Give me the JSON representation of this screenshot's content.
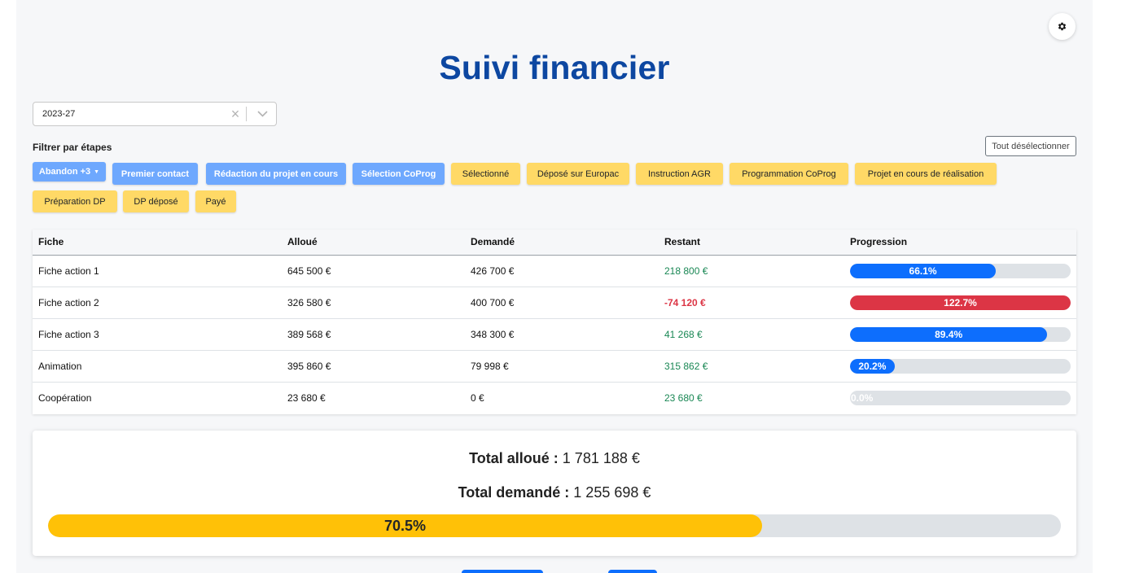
{
  "title": "Suivi financier",
  "year_select": {
    "value": "2023-27"
  },
  "filter": {
    "label": "Filtrer par étapes",
    "deselect_all": "Tout désélectionner",
    "chips": [
      {
        "label": "Abandon +3",
        "state": "selected",
        "dropdown": true
      },
      {
        "label": "Premier contact",
        "state": "selected"
      },
      {
        "label": "Rédaction du projet en cours",
        "state": "selected"
      },
      {
        "label": "Sélection CoProg",
        "state": "selected"
      },
      {
        "label": "Sélectionné",
        "state": "unselected"
      },
      {
        "label": "Déposé sur Europac",
        "state": "unselected"
      },
      {
        "label": "Instruction AGR",
        "state": "unselected"
      },
      {
        "label": "Programmation CoProg",
        "state": "unselected"
      },
      {
        "label": "Projet en cours de réalisation",
        "state": "unselected"
      },
      {
        "label": "Préparation DP",
        "state": "unselected"
      },
      {
        "label": "DP déposé",
        "state": "unselected"
      },
      {
        "label": "Payé",
        "state": "unselected"
      }
    ]
  },
  "table": {
    "headers": [
      "Fiche",
      "Alloué",
      "Demandé",
      "Restant",
      "Progression"
    ],
    "rows": [
      {
        "fiche": "Fiche action 1",
        "alloue": "645 500 €",
        "demande": "426 700 €",
        "restant": "218 800 €",
        "restant_status": "positive",
        "progression_label": "66.1%",
        "progression": 66.1
      },
      {
        "fiche": "Fiche action 2",
        "alloue": "326 580 €",
        "demande": "400 700 €",
        "restant": "-74 120 €",
        "restant_status": "negative",
        "progression_label": "122.7%",
        "progression": 122.7
      },
      {
        "fiche": "Fiche action 3",
        "alloue": "389 568 €",
        "demande": "348 300 €",
        "restant": "41 268 €",
        "restant_status": "positive",
        "progression_label": "89.4%",
        "progression": 89.4
      },
      {
        "fiche": "Animation",
        "alloue": "395 860 €",
        "demande": "79 998 €",
        "restant": "315 862 €",
        "restant_status": "positive",
        "progression_label": "20.2%",
        "progression": 20.2
      },
      {
        "fiche": "Coopération",
        "alloue": "23 680 €",
        "demande": "0 €",
        "restant": "23 680 €",
        "restant_status": "positive",
        "progression_label": "0.0%",
        "progression": 0.0
      }
    ]
  },
  "summary": {
    "total_alloue_label": "Total alloué :",
    "total_alloue_value": "1 781 188 €",
    "total_demande_label": "Total demandé :",
    "total_demande_value": "1 255 698 €",
    "progress_label": "70.5%",
    "progress": 70.5
  },
  "colors": {
    "title": "#0d47a1",
    "chip_selected": "#6ea8fe",
    "chip_unselected": "#ffd966",
    "progress_ok": "#0d6efd",
    "progress_over": "#dc3545",
    "positive": "#198754",
    "negative": "#dc3545",
    "summary_progress": "#ffc107"
  },
  "icons": {
    "settings": "gear-icon",
    "clear": "clear-x-icon",
    "dropdown": "chevron-down-icon"
  }
}
